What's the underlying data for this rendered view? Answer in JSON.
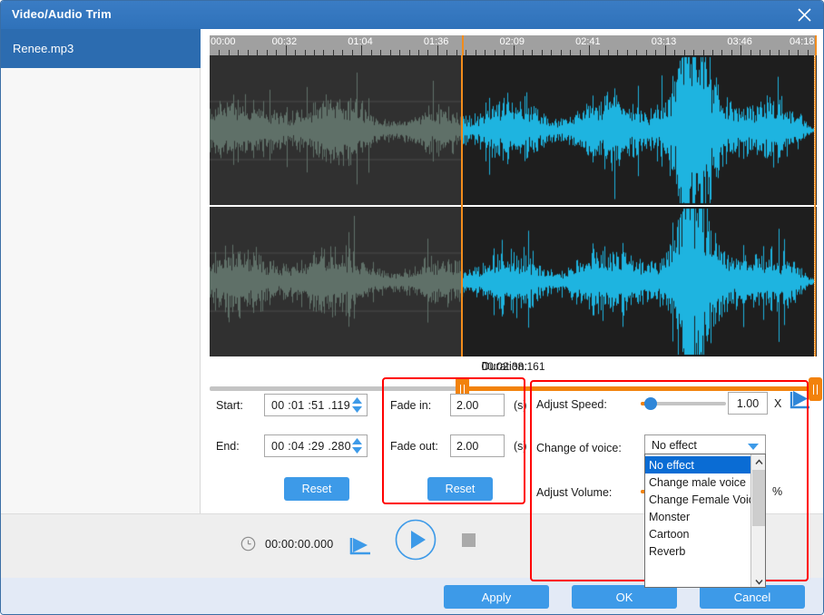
{
  "window": {
    "title": "Video/Audio Trim",
    "close_icon": "close-icon"
  },
  "sidebar": {
    "files": [
      {
        "name": "Renee.mp3"
      }
    ]
  },
  "timeline": {
    "ruler_labels": [
      "00:00",
      "00:32",
      "01:04",
      "01:36",
      "02:09",
      "02:41",
      "03:13",
      "03:46",
      "04:18"
    ],
    "duration_label": "Duration:",
    "duration_value": "00:02:38.161",
    "selection_start_pct": 41.5,
    "selection_end_pct": 99.7,
    "colors": {
      "selected_wave": "#1eb4e0",
      "unselected_wave": "#5f7068",
      "marker": "#f2820c",
      "ruler_bg": "#a0a0a0"
    }
  },
  "trim": {
    "start_label": "Start:",
    "start_value": "00 :01 :51 .119",
    "end_label": "End:",
    "end_value": "00 :04 :29 .280",
    "reset_label": "Reset"
  },
  "fade": {
    "fade_in_label": "Fade in:",
    "fade_in_value": "2.00",
    "fade_in_unit": "(s)",
    "fade_out_label": "Fade out:",
    "fade_out_value": "2.00",
    "fade_out_unit": "(s)",
    "reset_label": "Reset"
  },
  "effects": {
    "speed_label": "Adjust Speed:",
    "speed_value": "1.00",
    "speed_unit": "X",
    "speed_slider_pct": 12,
    "preview_icon": "play-preview-icon",
    "voice_label": "Change of voice:",
    "voice_selected": "No effect",
    "voice_options": [
      "No effect",
      "Change male voice",
      "Change Female Voice",
      "Monster",
      "Cartoon",
      "Reverb"
    ],
    "volume_label": "Adjust Volume:",
    "volume_unit": "%"
  },
  "playback": {
    "clock_icon": "clock-icon",
    "current_time": "00:00:00.000",
    "preview_icon": "play-to-marker-icon",
    "play_icon": "play-icon",
    "stop_icon": "stop-icon"
  },
  "footer": {
    "apply_label": "Apply",
    "ok_label": "OK",
    "cancel_label": "Cancel"
  }
}
